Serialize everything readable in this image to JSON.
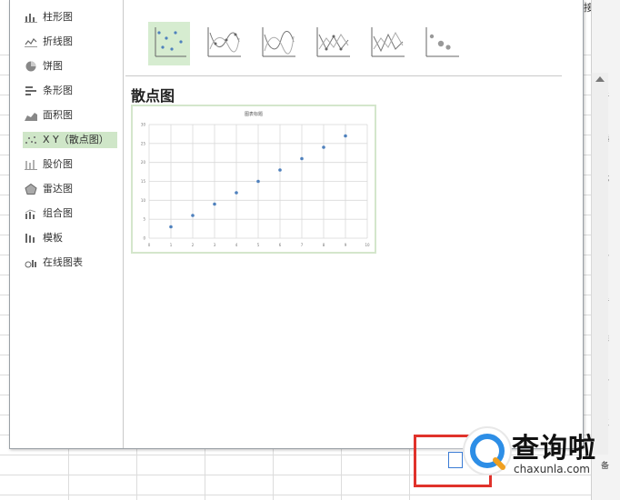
{
  "sidebar": {
    "items": [
      {
        "label": "柱形图",
        "icon": "column-chart-icon"
      },
      {
        "label": "折线图",
        "icon": "line-chart-icon"
      },
      {
        "label": "饼图",
        "icon": "pie-chart-icon"
      },
      {
        "label": "条形图",
        "icon": "bar-chart-icon"
      },
      {
        "label": "面积图",
        "icon": "area-chart-icon"
      },
      {
        "label": "X Y（散点图）",
        "icon": "scatter-chart-icon"
      },
      {
        "label": "股价图",
        "icon": "stock-chart-icon"
      },
      {
        "label": "雷达图",
        "icon": "radar-chart-icon"
      },
      {
        "label": "组合图",
        "icon": "combo-chart-icon"
      },
      {
        "label": "模板",
        "icon": "template-icon"
      },
      {
        "label": "在线图表",
        "icon": "online-chart-icon"
      }
    ],
    "selected_index": 5
  },
  "subtypes": [
    "scatter-markers-icon",
    "scatter-smooth-markers-icon",
    "scatter-smooth-icon",
    "scatter-straight-markers-icon",
    "scatter-straight-icon",
    "bubble-icon"
  ],
  "preview": {
    "heading": "散点图",
    "chart_title": "图表标题"
  },
  "chart_data": {
    "type": "scatter",
    "title": "图表标题",
    "x": [
      1,
      2,
      3,
      4,
      5,
      6,
      7,
      8,
      9
    ],
    "y": [
      3,
      6,
      9,
      12,
      15,
      18,
      21,
      24,
      27
    ],
    "xlim": [
      0,
      10
    ],
    "ylim": [
      0,
      30
    ],
    "y_ticks": [
      "0",
      "5",
      "10",
      "15",
      "20",
      "25",
      "30"
    ],
    "x_ticks": [
      "0",
      "1",
      "2",
      "3",
      "4",
      "5",
      "6",
      "7",
      "8",
      "9",
      "10"
    ],
    "grid": true,
    "marker_color": "#4f81bd"
  },
  "topbar": {
    "fragment": "接"
  },
  "rightpane": {
    "fragments": [
      "新",
      "选",
      "邢",
      "启",
      "分",
      "传",
      "推",
      "分",
      "工",
      "备"
    ]
  },
  "watermark": {
    "text": "查询啦",
    "domain": "chaxunla.com"
  },
  "colors": {
    "selection": "#cfe6c8",
    "highlight_border": "#e0322b",
    "accent": "#3a7bd5"
  }
}
